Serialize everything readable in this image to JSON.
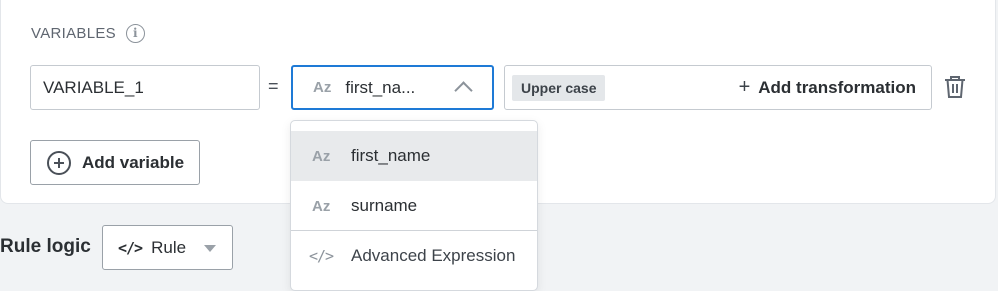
{
  "variables_section": {
    "title": "VARIABLES",
    "info_icon": "info-icon",
    "rows": [
      {
        "name_value": "VARIABLE_1",
        "operator": "=",
        "source": {
          "type_icon": "Az",
          "selected_value": "first_na..."
        },
        "transformations": [
          "Upper case"
        ],
        "add_transformation_label": "Add transformation",
        "delete_icon": "trash-icon"
      }
    ],
    "add_variable_label": "Add variable"
  },
  "rule_logic": {
    "label": "Rule logic",
    "select_icon": "code-icon",
    "select_value": "Rule"
  },
  "dropdown": {
    "options": [
      {
        "icon": "Az",
        "label": "first_name",
        "highlighted": true
      },
      {
        "icon": "Az",
        "label": "surname",
        "highlighted": false
      },
      {
        "icon": "</>",
        "label": "Advanced Expression",
        "highlighted": false
      }
    ]
  },
  "colors": {
    "focus_border": "#1e7ad6",
    "chip_background": "#e4e7ea",
    "highlight_background": "#e8eaec",
    "page_background": "#f1f3f5"
  }
}
